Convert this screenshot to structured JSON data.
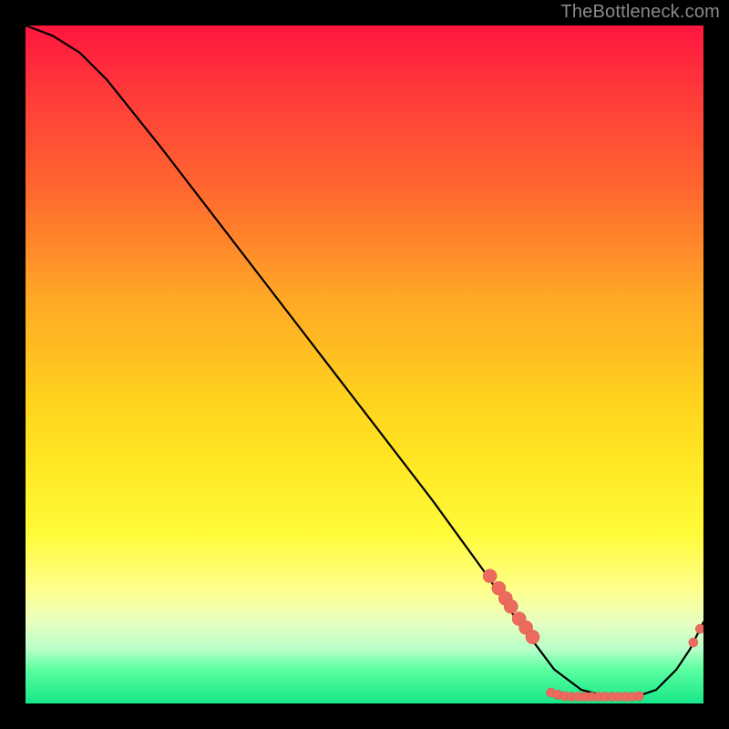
{
  "attribution": "TheBottleneck.com",
  "chart_data": {
    "type": "line",
    "title": "",
    "xlabel": "",
    "ylabel": "",
    "xlim": [
      0,
      100
    ],
    "ylim": [
      0,
      100
    ],
    "grid": false,
    "line": {
      "x": [
        0,
        4,
        8,
        12,
        20,
        30,
        40,
        50,
        60,
        68,
        72,
        75,
        78,
        82,
        86,
        90,
        93,
        96,
        98,
        100
      ],
      "y": [
        100,
        98.5,
        96,
        92,
        82,
        69,
        56,
        43,
        30,
        19,
        13,
        9,
        5,
        2,
        1,
        1,
        2,
        5,
        8,
        12
      ]
    },
    "markers_left": {
      "x": [
        68.5,
        69.8,
        70.8,
        71.6,
        72.8,
        73.8,
        74.8
      ],
      "y": [
        18.8,
        17.0,
        15.5,
        14.3,
        12.5,
        11.2,
        9.8
      ]
    },
    "markers_bottom": {
      "x": [
        77.5,
        78.5,
        79.5,
        80.5,
        81.5,
        82.5,
        83.5,
        84.5,
        85.5,
        86.5,
        87.5,
        88.5,
        89.5,
        90.5
      ],
      "y": [
        1.6,
        1.3,
        1.1,
        1.0,
        1.0,
        1.0,
        1.0,
        1.0,
        1.0,
        1.0,
        1.0,
        1.0,
        1.0,
        1.1
      ]
    },
    "markers_right": {
      "x": [
        98.5,
        99.5
      ],
      "y": [
        9.0,
        11.0
      ]
    },
    "marker_radius_small": 5.0,
    "marker_radius_large": 7.5,
    "colors": {
      "line": "#000000",
      "marker": "#ec6b5e",
      "gradient_top": "#ff163e",
      "gradient_mid": "#ffe824",
      "gradient_bottom": "#17e688",
      "attribution_text": "#8a8a8a"
    }
  }
}
